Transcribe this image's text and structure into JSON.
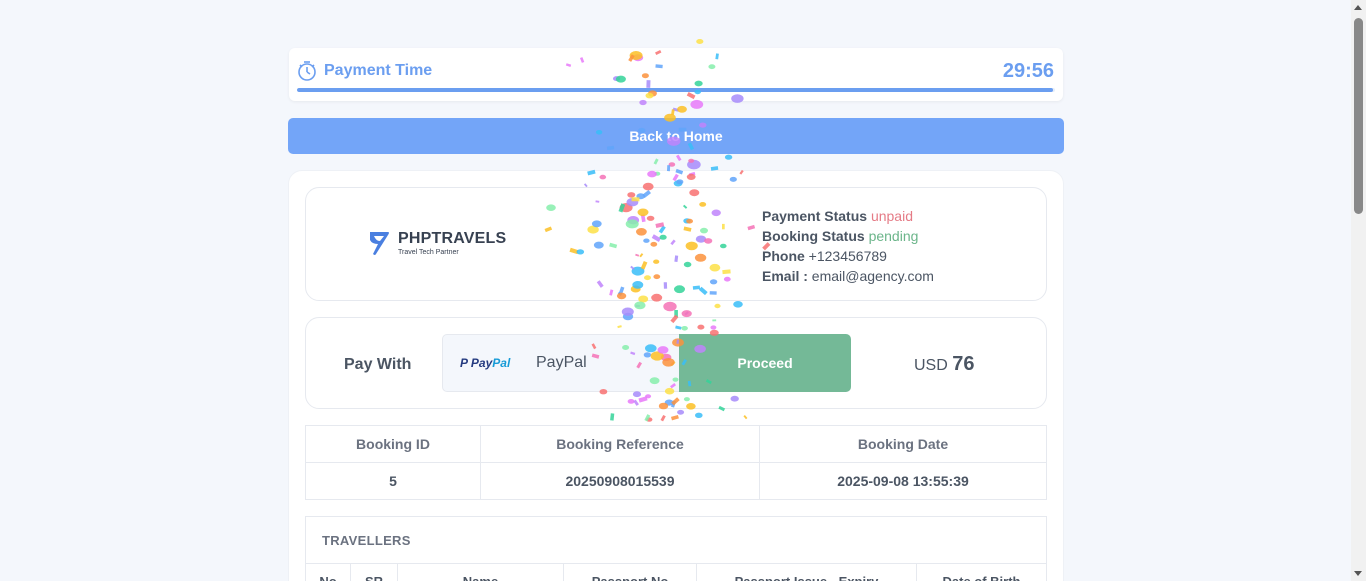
{
  "timer": {
    "label": "Payment Time",
    "value": "29:56",
    "progress_percent": 99.8
  },
  "back_button": "Back to Home",
  "brand": {
    "name": "PHPTRAVELS",
    "tagline": "Travel Tech Partner"
  },
  "status": {
    "payment_status_label": "Payment Status",
    "payment_status": "unpaid",
    "booking_status_label": "Booking Status",
    "booking_status": "pending",
    "phone_label": "Phone",
    "phone": "+123456789",
    "email_label": "Email :",
    "email": "email@agency.com"
  },
  "payment": {
    "pay_with_label": "Pay With",
    "method_logo": "PayPal",
    "method_name": "PayPal",
    "proceed_label": "Proceed",
    "currency": "USD",
    "amount": "76"
  },
  "booking_table": {
    "headers": [
      "Booking ID",
      "Booking Reference",
      "Booking Date"
    ],
    "row": [
      "5",
      "20250908015539",
      "2025-09-08 13:55:39"
    ]
  },
  "travellers": {
    "title": "TRAVELLERS",
    "headers": [
      "No",
      "SR",
      "Name",
      "Passport No",
      "Passport Issue - Expiry",
      "Date of Birth"
    ]
  },
  "colors": {
    "accent": "#73a5f8",
    "proceed": "#74b997",
    "unpaid": "#e57b86",
    "pending": "#6bb58a"
  },
  "icons": [
    "stopwatch-icon",
    "phptravels-logo",
    "paypal-logo",
    "scroll-up-icon",
    "scroll-down-icon"
  ]
}
